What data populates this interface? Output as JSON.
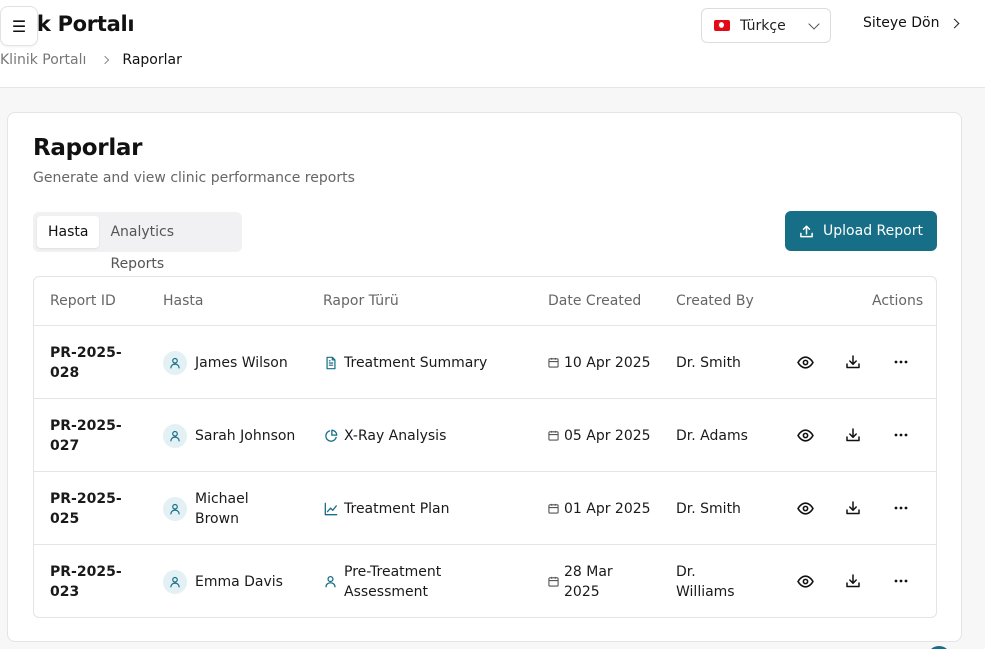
{
  "header": {
    "app_title": "ik Portalı",
    "menu_icon": "☰",
    "language": "Türkçe",
    "back_label": "Siteye Dön"
  },
  "breadcrumb": {
    "items": [
      "Klinik Portalı",
      "Raporlar"
    ]
  },
  "page": {
    "title": "Raporlar",
    "subtitle": "Generate and view clinic performance reports",
    "tabs": [
      {
        "label": "Hasta",
        "active": true
      },
      {
        "label": "Analytics Reports",
        "active": false
      }
    ],
    "upload_label": "Upload Report"
  },
  "table": {
    "headers": {
      "id": "Report ID",
      "patient": "Hasta",
      "type": "Rapor Türü",
      "date": "Date Created",
      "by": "Created By",
      "actions": "Actions"
    },
    "rows": [
      {
        "id_1": "PR-2025-",
        "id_2": "028",
        "patient_1": "James Wilson",
        "patient_2": "",
        "type_icon": "document-icon",
        "type_1": "Treatment Summary",
        "type_2": "",
        "date_1": "10 Apr 2025",
        "date_2": "",
        "by_1": "Dr. Smith",
        "by_2": ""
      },
      {
        "id_1": "PR-2025-",
        "id_2": "027",
        "patient_1": "Sarah Johnson",
        "patient_2": "",
        "type_icon": "pie-chart-icon",
        "type_1": "X-Ray Analysis",
        "type_2": "",
        "date_1": "05 Apr 2025",
        "date_2": "",
        "by_1": "Dr. Adams",
        "by_2": ""
      },
      {
        "id_1": "PR-2025-",
        "id_2": "025",
        "patient_1": "Michael",
        "patient_2": "Brown",
        "type_icon": "line-chart-icon",
        "type_1": "Treatment Plan",
        "type_2": "",
        "date_1": "01 Apr 2025",
        "date_2": "",
        "by_1": "Dr. Smith",
        "by_2": ""
      },
      {
        "id_1": "PR-2025-",
        "id_2": "023",
        "patient_1": "Emma Davis",
        "patient_2": "",
        "type_icon": "user-icon",
        "type_1": "Pre-Treatment",
        "type_2": "Assessment",
        "date_1": "28 Mar",
        "date_2": "2025",
        "by_1": "Dr.",
        "by_2": "Williams"
      }
    ]
  },
  "colors": {
    "accent": "#176f87",
    "avatar_bg": "#e3f0f4"
  }
}
